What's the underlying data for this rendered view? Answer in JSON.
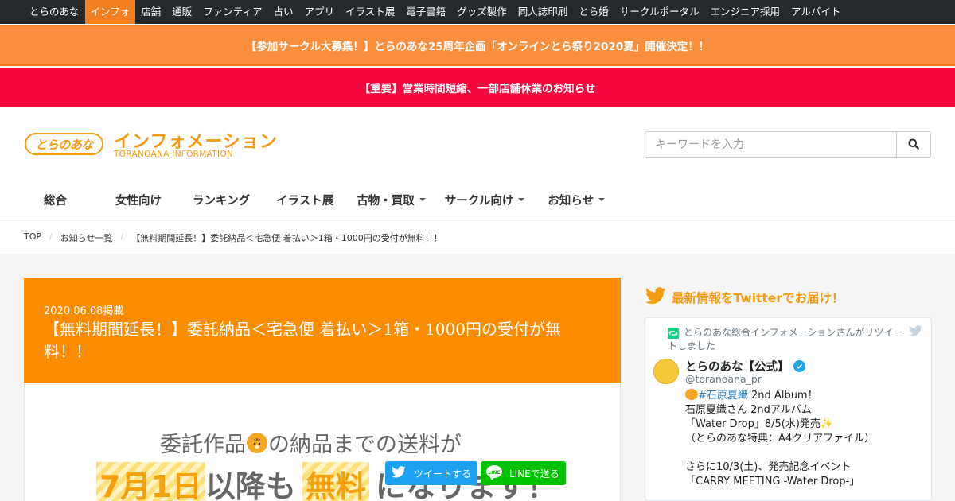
{
  "topnav": {
    "items": [
      "とらのあな",
      "インフォ",
      "店舗",
      "通販",
      "ファンティア",
      "占い",
      "アプリ",
      "イラスト展",
      "電子書籍",
      "グッズ製作",
      "同人誌印刷",
      "とら婚",
      "サークルポータル",
      "エンジニア採用",
      "アルバイト"
    ],
    "active_index": 1
  },
  "banners": {
    "orange": "【参加サークル大募集！】とらのあな25周年企画「オンラインとら祭り2020夏」開催決定！！",
    "red": "【重要】営業時間短縮、一部店舗休業のお知らせ"
  },
  "header": {
    "logo_text": "とらのあな",
    "brand_title": "インフォメーション",
    "brand_subtitle": "TORANOANA INFORMATION"
  },
  "search": {
    "placeholder": "キーワードを入力"
  },
  "mainnav": {
    "items": [
      {
        "label": "総合",
        "dropdown": false
      },
      {
        "label": "女性向け",
        "dropdown": false
      },
      {
        "label": "ランキング",
        "dropdown": false
      },
      {
        "label": "イラスト展",
        "dropdown": false
      },
      {
        "label": "古物・買取",
        "dropdown": true
      },
      {
        "label": "サークル向け",
        "dropdown": true
      },
      {
        "label": "お知らせ",
        "dropdown": true
      }
    ]
  },
  "breadcrumb": {
    "items": [
      "TOP",
      "お知らせ一覧",
      "【無料期間延長！】委託納品＜宅急便 着払い＞1箱・1000円の受付が無料！！"
    ]
  },
  "article": {
    "date": "2020.06.08掲載",
    "title": "【無料期間延長！】委託納品＜宅急便 着払い＞1箱・1000円の受付が無料！！",
    "hero_line1_a": "委託作品",
    "hero_line1_b": "の納品までの送料が",
    "hero_line2_a": "7月1日",
    "hero_line2_b": "以降も",
    "hero_line2_c": "無料",
    "hero_line2_d": "になります！"
  },
  "share": {
    "tweet_label": "ツイートする",
    "line_label": "LINEで送る"
  },
  "sidebar": {
    "heading": "最新情報をTwitterでお届け！",
    "retweet_text": "とらのあな総合インフォメーションさんがリツイートしました",
    "account_name": "とらのあな【公式】",
    "account_handle": "@toranoana_pr",
    "tweet_hashtag": "#石原夏織",
    "tweet_line1_rest": " 2nd Album！",
    "tweet_body": "石原夏織さん 2ndアルバム\n「Water Drop」8/5(水)発売✨\n（とらのあな特典：A4クリアファイル）\n\nさらに10/3(土)、発売記念イベント\n「CARRY MEETING -Water Drop-」"
  },
  "colors": {
    "accent": "#f47f20",
    "orange_banner": "#f98f3c",
    "red_banner": "#f5063d",
    "brand": "#f59a13",
    "article_header": "#fb8c00",
    "twitter": "#1da1f2",
    "line": "#00c300"
  },
  "icons": [
    "search-icon",
    "twitter-bird-icon",
    "retweet-icon",
    "verified-icon",
    "line-icon",
    "tiger-emoji-icon",
    "sparkles-icon",
    "caret-down-icon"
  ]
}
